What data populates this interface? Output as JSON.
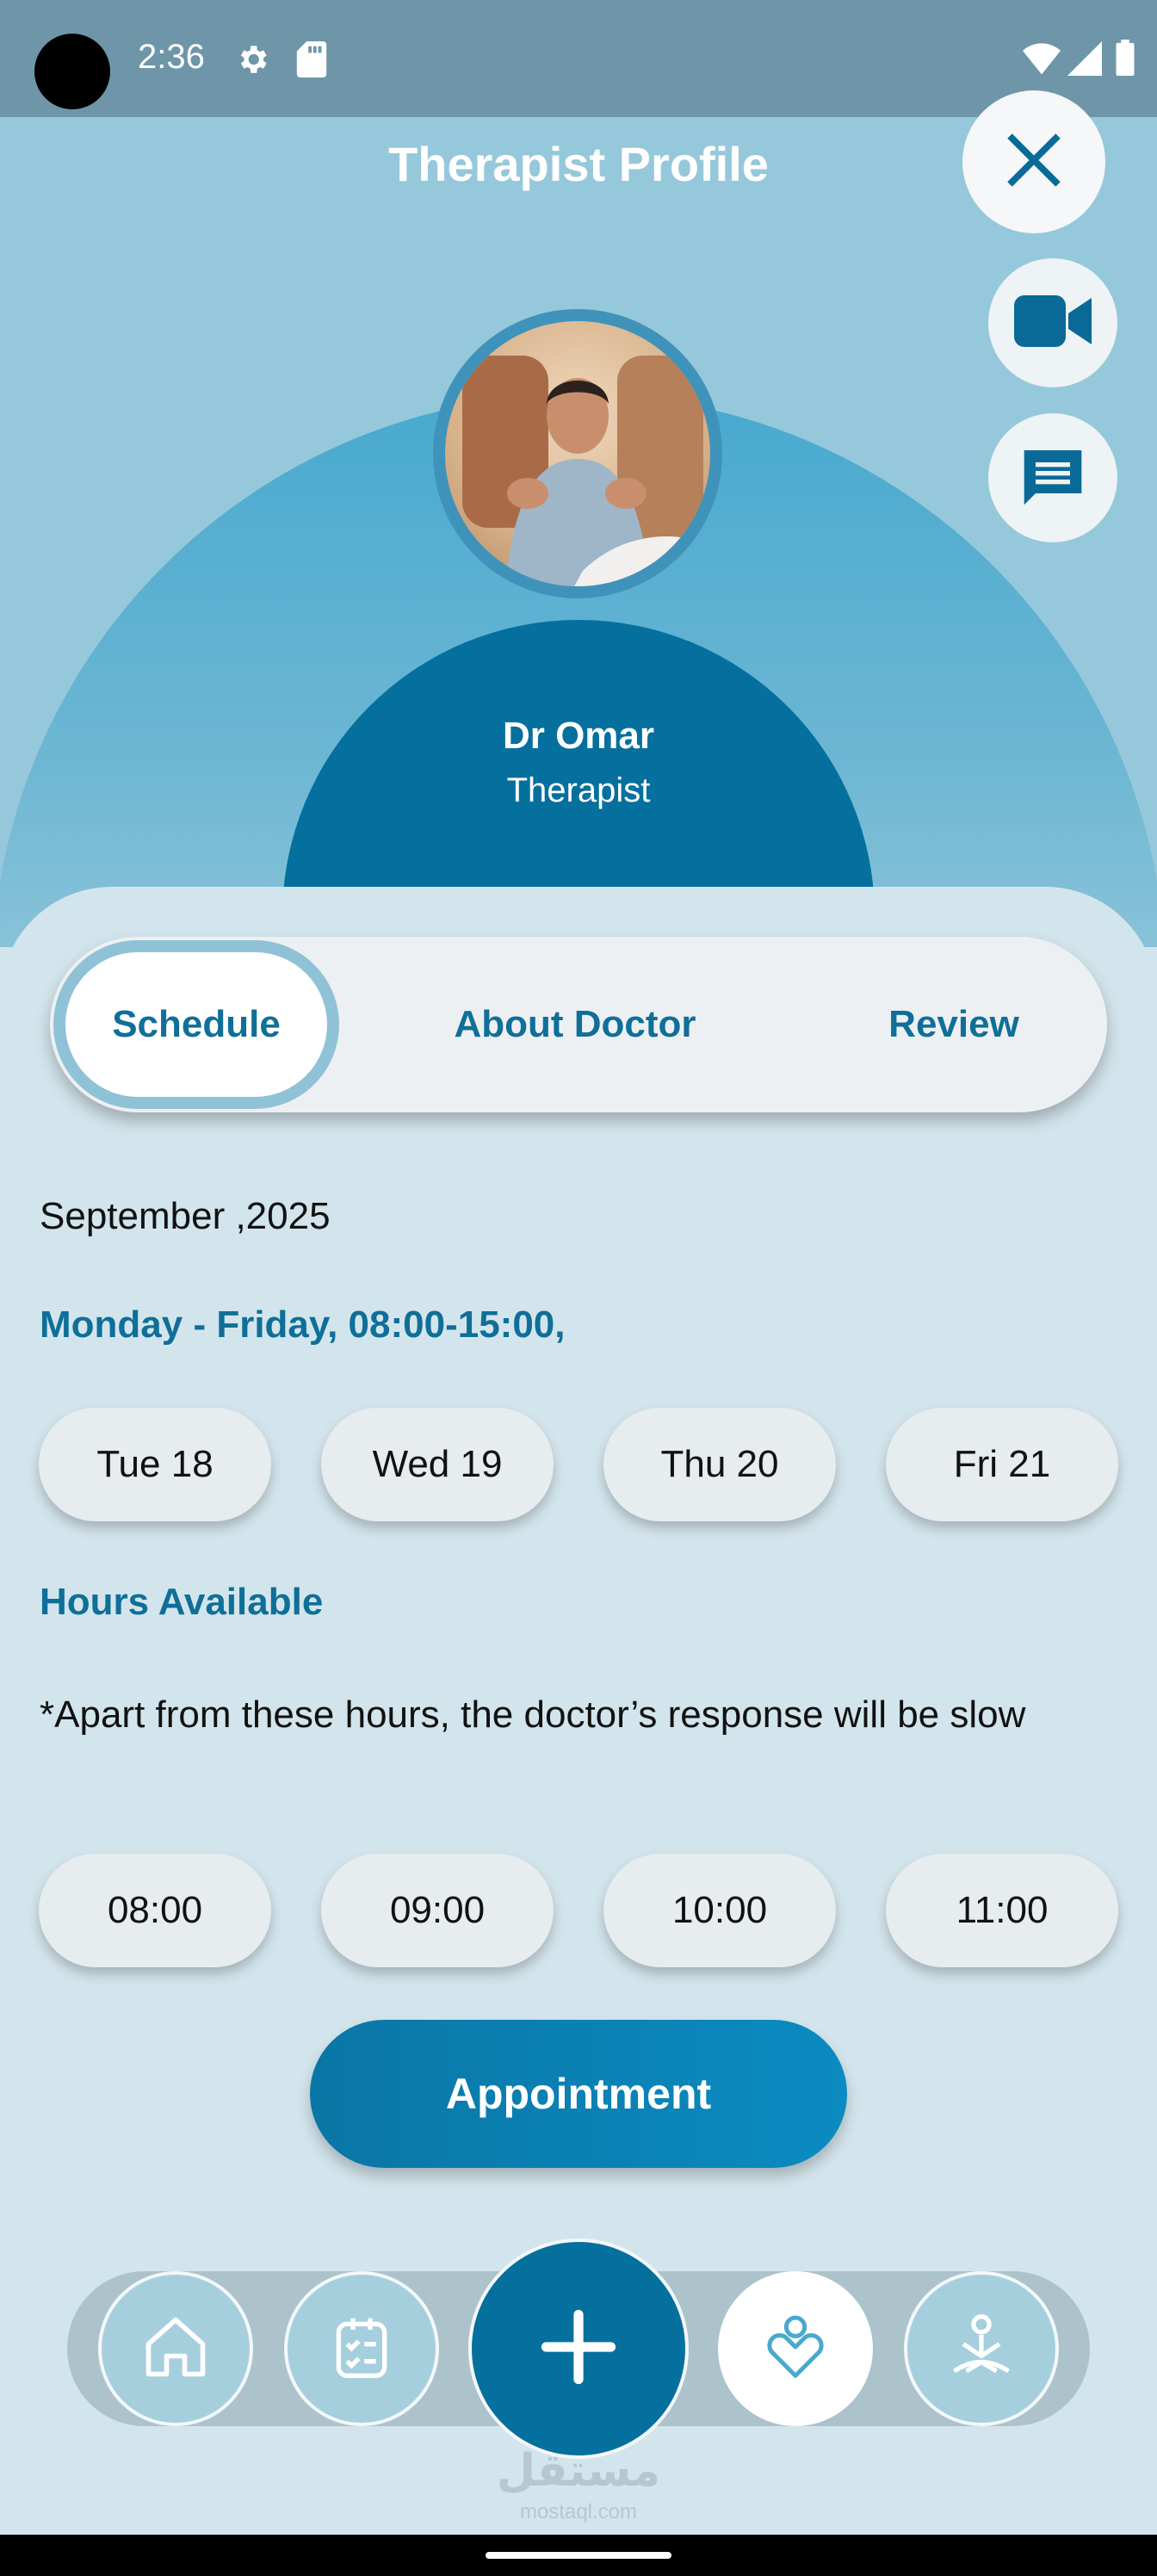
{
  "status_bar": {
    "time": "2:36"
  },
  "header": {
    "title": "Therapist Profile"
  },
  "doctor": {
    "name": "Dr Omar",
    "role": "Therapist"
  },
  "tabs": [
    {
      "label": "Schedule",
      "active": true
    },
    {
      "label": "About Doctor",
      "active": false
    },
    {
      "label": "Review",
      "active": false
    }
  ],
  "schedule": {
    "month": "September ,2025",
    "working_days": "Monday - Friday, 08:00-15:00,",
    "days": [
      "Tue 18",
      "Wed 19",
      "Thu 20",
      "Fri 21"
    ],
    "hours_title": "Hours Available",
    "hours_note": "*Apart from these hours, the doctor’s response will be slow",
    "hours": [
      "08:00",
      "09:00",
      "10:00",
      "11:00"
    ],
    "appointment_label": "Appointment"
  },
  "bottom_nav": {
    "items": [
      "home-icon",
      "checklist-icon",
      "add-icon",
      "therapist-heart-icon",
      "meditation-icon"
    ],
    "selected": "therapist-heart-icon"
  },
  "watermark": {
    "text": "مستقل",
    "sub": "mostaql.com"
  },
  "colors": {
    "primary": "#05709e",
    "accent_text": "#0f6f98",
    "button": "#0b8bc1",
    "background": "#d3e5ec",
    "header_bg": "#96c8db"
  }
}
